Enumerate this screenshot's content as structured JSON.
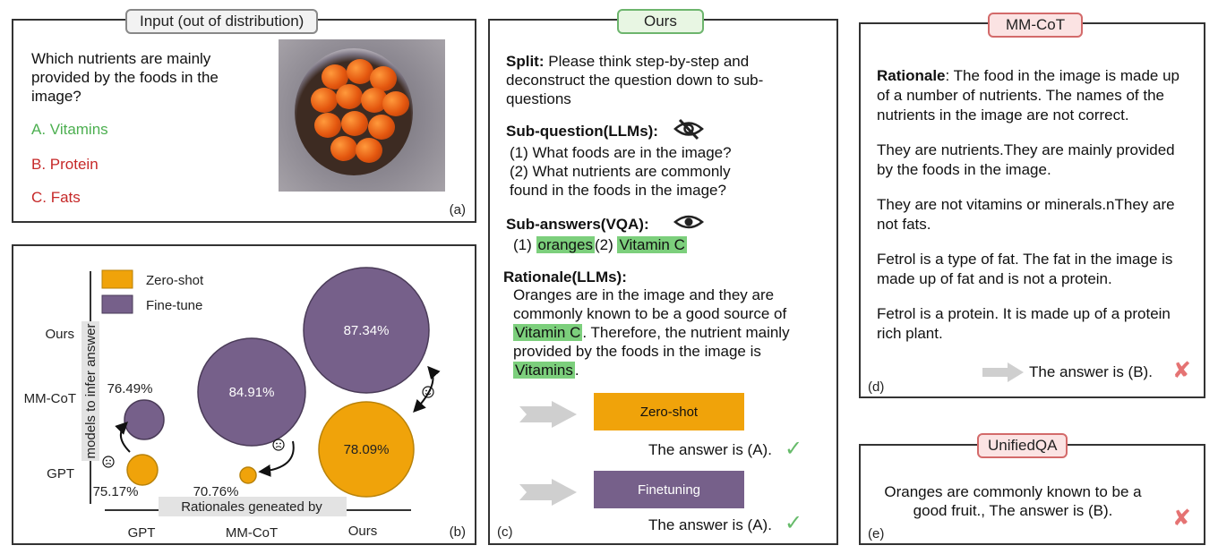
{
  "panel_a": {
    "tag": "Input (out of distribution)",
    "question_lines": [
      "Which nutrients are mainly",
      "provided by the foods in the",
      "image?"
    ],
    "options": [
      "A. Vitamins",
      "B. Protein",
      "C. Fats"
    ],
    "letter": "(a)"
  },
  "panel_b": {
    "letter": "(b)",
    "legend": [
      "Zero-shot",
      "Fine-tune"
    ],
    "ylabel": "models to infer answer",
    "xlabel": "Rationales geneated by",
    "y_ticks": [
      "Ours",
      "MM-CoT",
      "GPT"
    ],
    "x_ticks": [
      "GPT",
      "MM-CoT",
      "Ours"
    ],
    "bubble_labels": [
      "76.49%",
      "75.17%",
      "84.91%",
      "70.76%",
      "87.34%",
      "78.09%"
    ]
  },
  "chart_data": {
    "type": "scatter",
    "xlabel": "Rationales geneated by",
    "ylabel": "models to infer answer",
    "x_categories": [
      "GPT",
      "MM-CoT",
      "Ours"
    ],
    "y_categories": [
      "GPT",
      "MM-CoT",
      "Ours"
    ],
    "legend_position": "top-left",
    "series": [
      {
        "name": "Zero-shot",
        "color": "#f0a30a",
        "points": [
          {
            "x": "GPT",
            "y": "GPT",
            "value": 75.17
          },
          {
            "x": "MM-CoT",
            "y": "GPT",
            "value": 70.76
          },
          {
            "x": "Ours",
            "y": "GPT",
            "value": 78.09
          }
        ]
      },
      {
        "name": "Fine-tune",
        "color": "#76608a",
        "points": [
          {
            "x": "GPT",
            "y": "MM-CoT",
            "value": 76.49
          },
          {
            "x": "MM-CoT",
            "y": "MM-CoT",
            "value": 84.91
          },
          {
            "x": "Ours",
            "y": "Ours",
            "value": 87.34
          }
        ]
      }
    ]
  },
  "panel_c": {
    "tag": "Ours",
    "split_label": "Split:",
    "split_lines": [
      "Please think step-by-step and",
      "deconstruct the question down to sub-",
      "questions"
    ],
    "subq_label": "Sub-question(LLMs):",
    "subq_lines": [
      "(1) What foods are in the image?",
      "(2) What nutrients are commonly",
      "found in the foods in the image?"
    ],
    "suba_label": "Sub-answers(VQA):",
    "suba_prefix1": "(1)",
    "suba_hl1": "oranges",
    "suba_prefix2": "(2)",
    "suba_hl2": "Vitamin C",
    "rationale_label": "Rationale(LLMs):",
    "rationale_l1": "Oranges are in the image and they are",
    "rationale_l2": "commonly known to be a good source of",
    "rationale_l3_hl": "Vitamin C",
    "rationale_l3_rest": ". Therefore, the nutrient mainly",
    "rationale_l4": "provided by the   foods in the image is",
    "rationale_l5_hl": "Vitamins",
    "rationale_l5_rest": ".",
    "zero_shot_label": "Zero-shot",
    "zero_shot_answer": "The answer is (A).",
    "finetune_label": "Finetuning",
    "finetune_answer": "The answer is (A).",
    "check": "✓",
    "letter": "(c)"
  },
  "panel_d": {
    "tag": "MM-CoT",
    "rationale_label": "Rationale",
    "para1": ": The food in the image is made up of a number of nutrients. The names of the nutrients in the image are not correct.",
    "para2": "They are nutrients.They are mainly provided by the foods in the image.",
    "para3": "They are not vitamins or minerals.nThey are not fats.",
    "para4": "Fetrol is a type of fat. The fat in the image is made up of fat and is not a protein.",
    "para5": "Fetrol is a protein. It is made up of a protein rich plant.",
    "answer": "The answer is (B).",
    "cross": "✘",
    "letter": "(d)"
  },
  "panel_e": {
    "tag": "UnifiedQA",
    "line1": "Oranges are commonly known to be a",
    "line2": "good fruit., The answer is (B).",
    "cross": "✘",
    "letter": "(e)"
  },
  "colors": {
    "zero_shot": "#f0a30a",
    "fine_tune": "#76608a",
    "highlight": "#7ccf7c",
    "correct": "#4caf50",
    "wrong": "#e57373"
  }
}
